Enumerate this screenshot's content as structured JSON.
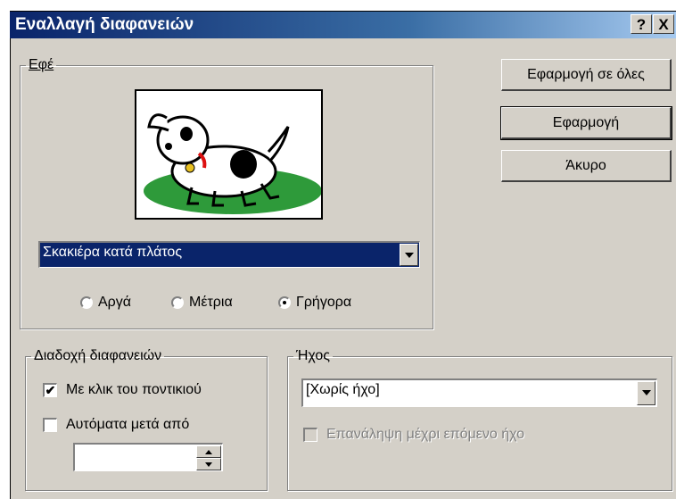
{
  "window": {
    "title": "Εναλλαγή διαφανειών",
    "help_label": "?",
    "close_label": "X"
  },
  "effect": {
    "legend": "Εφέ",
    "selected": "Σκακιέρα κατά πλάτος",
    "speed_options": [
      {
        "label": "Αργά",
        "checked": false
      },
      {
        "label": "Μέτρια",
        "checked": false
      },
      {
        "label": "Γρήγορα",
        "checked": true
      }
    ]
  },
  "buttons": {
    "apply_all": "Εφαρμογή σε όλες",
    "apply": "Εφαρμογή",
    "cancel": "Άκυρο"
  },
  "advance": {
    "legend": "Διαδοχή διαφανειών",
    "on_click": {
      "label": "Με κλικ του ποντικιού",
      "checked": true
    },
    "automatic": {
      "label": "Αυτόματα μετά από",
      "checked": false
    },
    "time_value": ""
  },
  "sound": {
    "legend": "Ήχος",
    "selected": "[Χωρίς ήχο]",
    "loop": {
      "label": "Επανάληψη μέχρι επόμενο ήχο",
      "checked": false,
      "enabled": false
    }
  },
  "colors": {
    "titlebar": "#0a246a",
    "face": "#d4d0c8",
    "selection": "#0a246a"
  }
}
